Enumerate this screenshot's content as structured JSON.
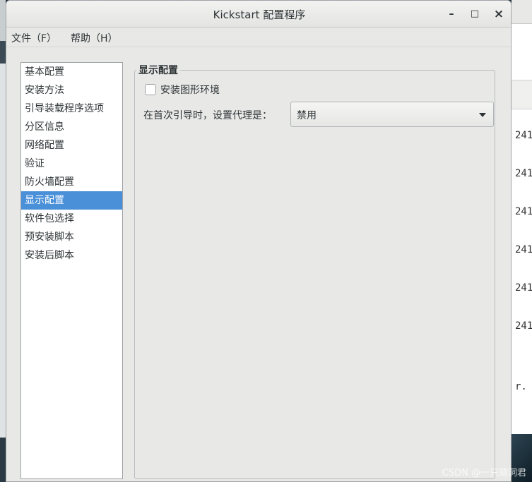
{
  "window": {
    "title": "Kickstart 配置程序",
    "controls": {
      "minimize": "–",
      "maximize": "□",
      "close": "×"
    }
  },
  "menu": {
    "file": "文件（F）",
    "help": "帮助（H）"
  },
  "sidebar": {
    "items": [
      {
        "label": "基本配置"
      },
      {
        "label": "安装方法"
      },
      {
        "label": "引导装载程序选项"
      },
      {
        "label": "分区信息"
      },
      {
        "label": "网络配置"
      },
      {
        "label": "验证"
      },
      {
        "label": "防火墙配置"
      },
      {
        "label": "显示配置",
        "selected": true
      },
      {
        "label": "软件包选择"
      },
      {
        "label": "预安装脚本"
      },
      {
        "label": "安装后脚本"
      }
    ]
  },
  "display_config": {
    "section_title": "显示配置",
    "install_graphical_env": {
      "label": "安装图形环境",
      "checked": false
    },
    "proxy_label": "在首次引导时，设置代理是：",
    "proxy_value": "禁用"
  },
  "background_terminal": {
    "lines": [
      "241",
      "241",
      "241",
      "241",
      "241",
      "241",
      "r. Y"
    ]
  },
  "watermark": "CSDN @一只脑洞君",
  "colors": {
    "selection": "#4a90d9",
    "window_bg": "#e8e8e7",
    "desktop_bg": "#1f2f3a"
  }
}
